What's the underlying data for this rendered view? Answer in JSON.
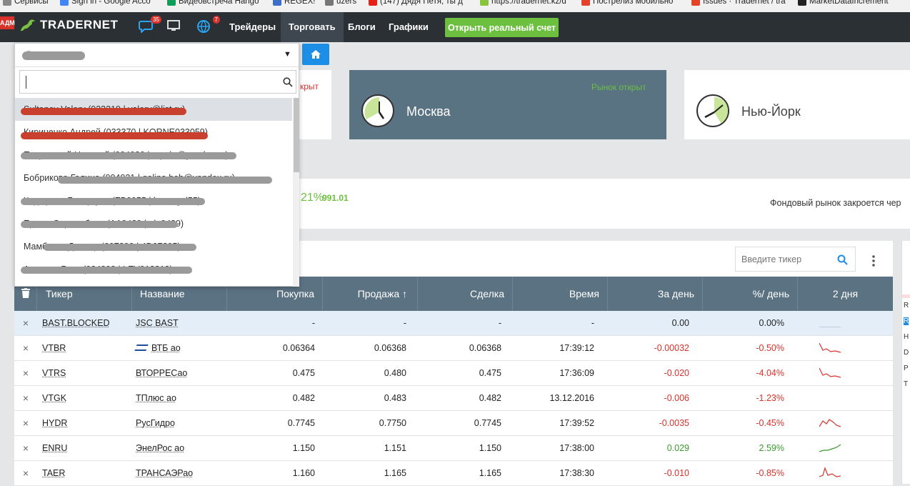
{
  "bookmarks": [
    {
      "label": "Сервисы",
      "icon": "grid-icon",
      "color": "#888888"
    },
    {
      "label": "Sign in - Google Acco",
      "icon": "google-icon",
      "color": "#4285f4"
    },
    {
      "label": "Видеовстреча Hango",
      "icon": "hangouts-icon",
      "color": "#0f9d58"
    },
    {
      "label": "REGEX!",
      "icon": "regex-icon",
      "color": "#3b6fc9"
    },
    {
      "label": "uzers",
      "icon": "uzers-icon",
      "color": "#777777"
    },
    {
      "label": "(147) Дядя Петя, ты д",
      "icon": "youtube-icon",
      "color": "#e62117"
    },
    {
      "label": "https://tradernet.kz/d",
      "icon": "tradernet-icon",
      "color": "#8ac43f"
    },
    {
      "label": "Пострелиз мобильно",
      "icon": "gitlab-icon",
      "color": "#e24329"
    },
    {
      "label": "Issues · Tradernet / tra",
      "icon": "gitlab-icon",
      "color": "#e24329"
    },
    {
      "label": "MarketDataIncrement",
      "icon": "fix-icon",
      "color": "#222222"
    }
  ],
  "nav": {
    "adm_label": "АДМ",
    "brand": "TRADERNET",
    "chat_badge": "35",
    "globe_badge": "7",
    "links": [
      "Трейдеры",
      "Торговать",
      "Блоги",
      "Графики"
    ],
    "active_link": "Торговать",
    "open_account": "Открыть реальный счет"
  },
  "markets": {
    "left_status": "крыт",
    "moscow": {
      "city": "Москва",
      "status": "Рынок открыт"
    },
    "newyork": {
      "city": "Нью-Йорк"
    }
  },
  "index_bar": {
    "percent": "21%",
    "value": "991.01",
    "closing_text": "Фондовый рынок закроется чер"
  },
  "ticker_search": {
    "placeholder": "Введите тикер"
  },
  "dropdown": {
    "selected_value": "@",
    "search_value": "",
    "items": [
      "Sultanov Valery (033319 | valery@list.ru)",
      "Кириченко Андрей (033370 | KORNE033059)",
      "Покровский Николай (004020 | n.pokr@yandex.ru)",
      "Бобрикова Галина (004021 | galina.bob@yandex.ru)",
      "Кадырова Базаргуль (ZB0055 | bazargul55)",
      "Ержан Сарсембаев (AA9489 | ala9489)",
      "Мамбетов Данияр (007290 | 4D07295)",
      "Асанова Роза (024398 | LEV012313)"
    ]
  },
  "table": {
    "headers": [
      "Тикер",
      "Название",
      "Покупка",
      "Продажа",
      "Сделка",
      "Время",
      "За день",
      "%/ день",
      "2 дня"
    ],
    "sort_indicator": "↑",
    "rows": [
      {
        "ticker": "BAST.BLOCKED",
        "name": "JSC BAST",
        "buy": "-",
        "sell": "-",
        "deal": "-",
        "time": "-",
        "day": "0.00",
        "pct": "0.00%",
        "trend": "none",
        "highlight": true
      },
      {
        "ticker": "VTBR",
        "name": "ВТБ ао",
        "buy": "0.06364",
        "sell": "0.06368",
        "deal": "0.06368",
        "time": "17:39:12",
        "day": "-0.00032",
        "pct": "-0.50%",
        "trend": "down",
        "logo": true
      },
      {
        "ticker": "VTRS",
        "name": "ВТОРРЕСао",
        "buy": "0.475",
        "sell": "0.480",
        "deal": "0.475",
        "time": "17:36:09",
        "day": "-0.020",
        "pct": "-4.04%",
        "trend": "down"
      },
      {
        "ticker": "VTGK",
        "name": "ТПлюс ао",
        "buy": "0.482",
        "sell": "0.483",
        "deal": "0.482",
        "time": "13.12.2016",
        "day": "-0.006",
        "pct": "-1.23%",
        "trend": "none"
      },
      {
        "ticker": "HYDR",
        "name": "РусГидро",
        "buy": "0.7745",
        "sell": "0.7750",
        "deal": "0.7745",
        "time": "17:39:52",
        "day": "-0.0035",
        "pct": "-0.45%",
        "trend": "mixed"
      },
      {
        "ticker": "ENRU",
        "name": "ЭнелРос ао",
        "buy": "1.150",
        "sell": "1.151",
        "deal": "1.150",
        "time": "17:38:00",
        "day": "0.029",
        "pct": "2.59%",
        "trend": "up"
      },
      {
        "ticker": "TAER",
        "name": "ТРАНСАЭРао",
        "buy": "1.160",
        "sell": "1.165",
        "deal": "1.165",
        "time": "17:38:30",
        "day": "-0.010",
        "pct": "-0.85%",
        "trend": "spike"
      }
    ]
  },
  "right_strip": [
    "R",
    "R",
    "H",
    "D",
    "P",
    "T"
  ],
  "colors": {
    "accent": "#1c8ee6",
    "positive": "#3c9b2e",
    "negative": "#d8322b",
    "header": "#5b7283",
    "brand_green": "#6cbf3f"
  }
}
